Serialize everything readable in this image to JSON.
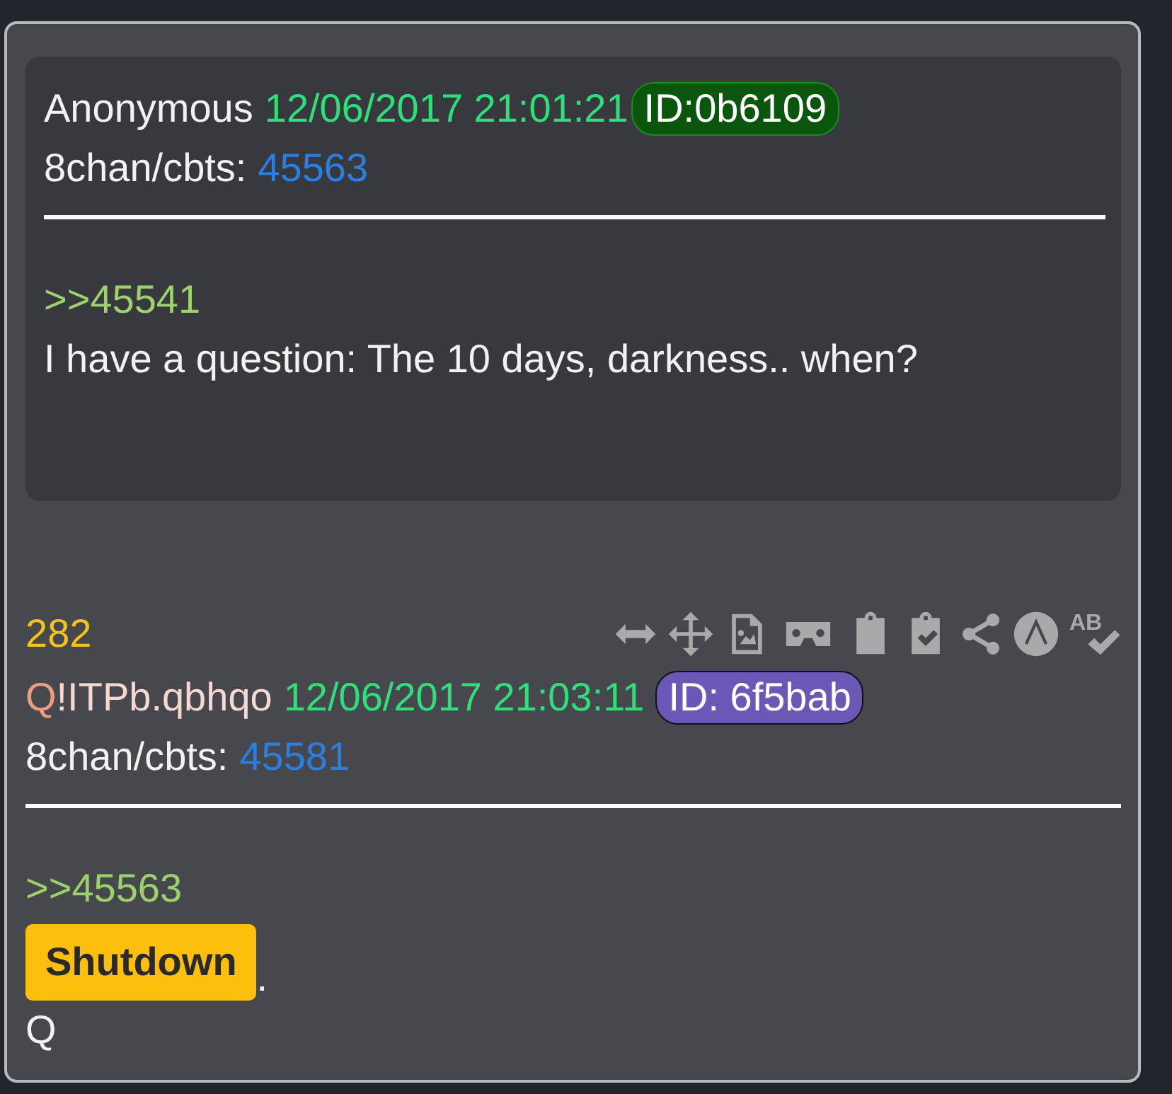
{
  "quoted_post": {
    "author": "Anonymous",
    "timestamp": "12/06/2017 21:01:21",
    "id_badge": "ID:0b6109",
    "board": "8chan/cbts:",
    "post_link": "45563",
    "reply_link": ">>45541",
    "message": "I have a question: The 10 days, darkness.. when?"
  },
  "post": {
    "number": "282",
    "toolbar_spellcheck_label": "AB",
    "tripcode_prefix": "Q",
    "tripcode": "!ITPb.qbhqo",
    "timestamp": "12/06/2017 21:03:11",
    "id_badge": "ID: 6f5bab",
    "board": "8chan/cbts:",
    "post_link": "45581",
    "reply_link": ">>45563",
    "highlight": "Shutdown",
    "after_highlight": ".",
    "signature": "Q"
  }
}
